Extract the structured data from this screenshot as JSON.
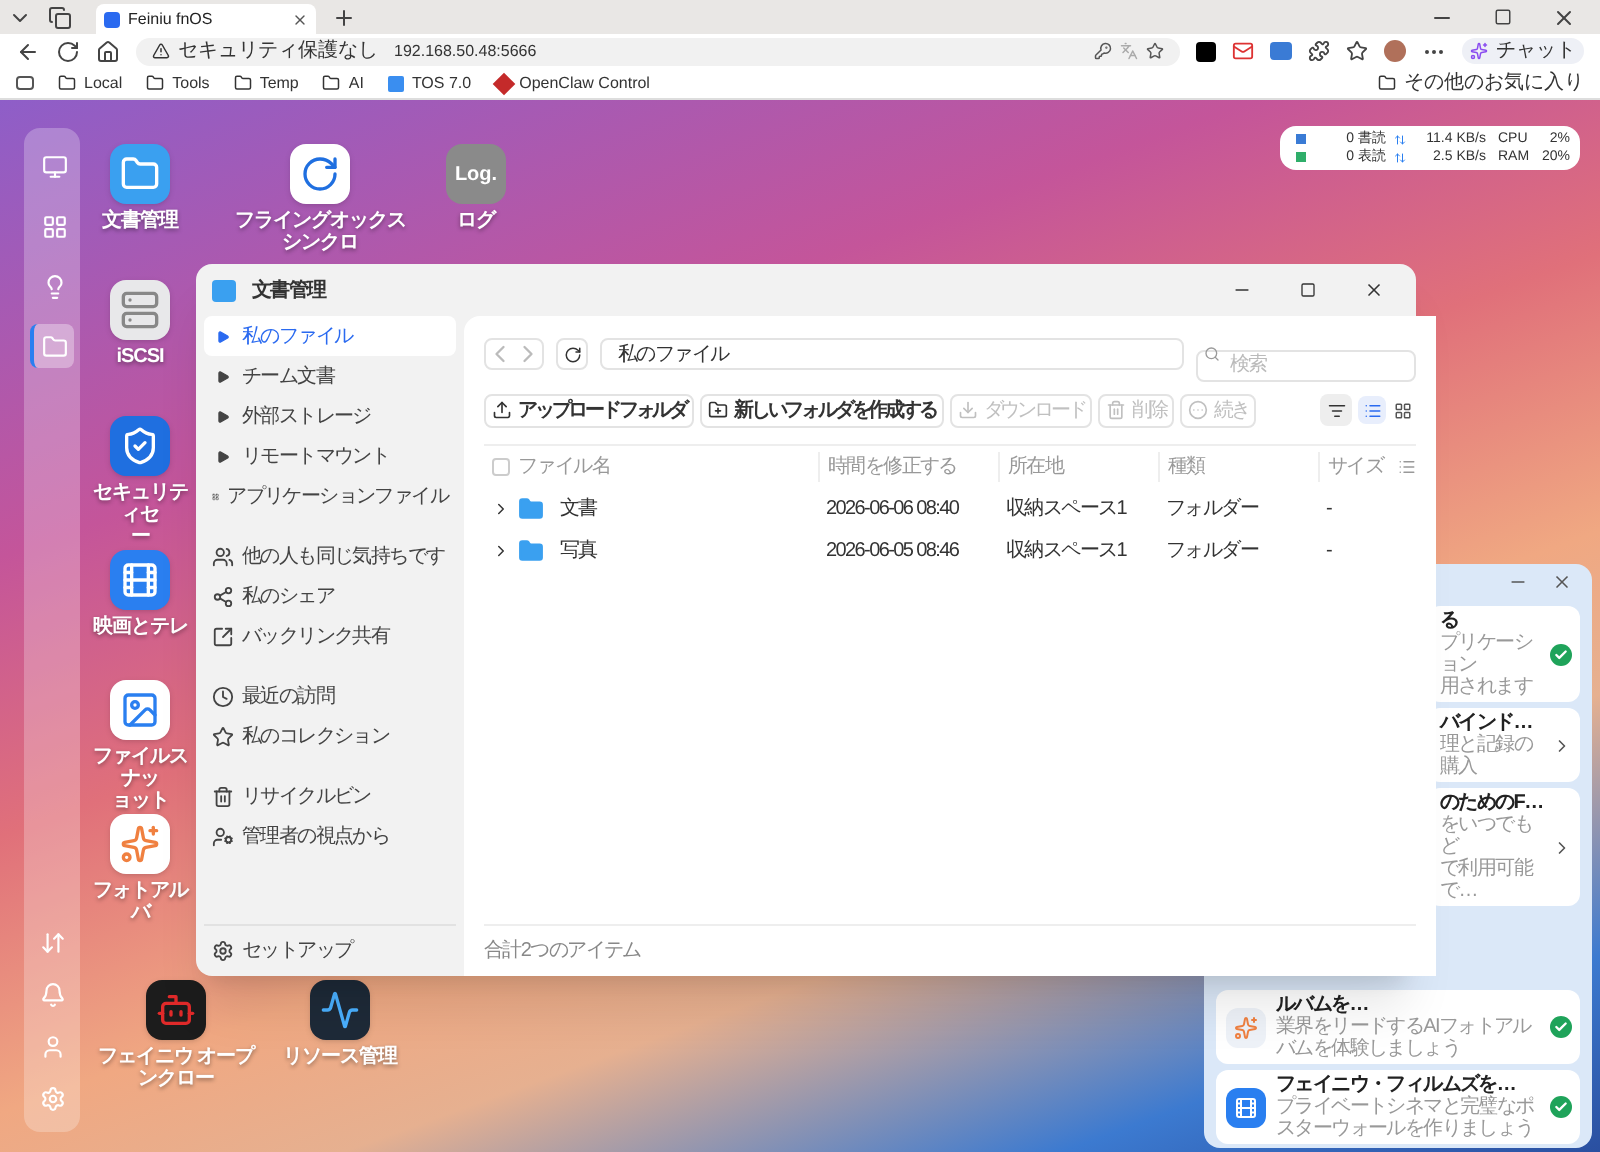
{
  "browser": {
    "tab_title": "Feiniu fnOS",
    "security": "セキュリティ保護なし",
    "url": "192.168.50.48:5666",
    "chat": "チャット",
    "bookmarks": [
      {
        "label": "Local",
        "kind": "folder"
      },
      {
        "label": "Tools",
        "kind": "folder"
      },
      {
        "label": "Temp",
        "kind": "folder"
      },
      {
        "label": "AI",
        "kind": "folder"
      },
      {
        "label": "TOS 7.0",
        "kind": "app"
      },
      {
        "label": "OpenClaw Control",
        "kind": "claw"
      }
    ],
    "other_favorites": "その他のお気に入り"
  },
  "dock": {
    "items": [
      {
        "kind": "monitor",
        "selected": false
      },
      {
        "kind": "apps",
        "selected": false
      },
      {
        "kind": "bulb",
        "selected": false
      },
      {
        "kind": "files",
        "selected": true
      }
    ],
    "bottom_items": [
      {
        "kind": "transfer"
      },
      {
        "kind": "bell"
      },
      {
        "kind": "user"
      },
      {
        "kind": "settings"
      }
    ]
  },
  "desktop_icons": [
    {
      "kind": "folder",
      "lines": [
        "文書管理"
      ]
    },
    {
      "kind": "sync",
      "lines": [
        "フライングオックス",
        "シンクロ"
      ]
    },
    {
      "kind": "log",
      "icon_text": "Log.",
      "lines": [
        "ログ"
      ]
    },
    {
      "kind": "server",
      "lines": [
        "iSCSI"
      ]
    },
    {
      "kind": "shield",
      "lines": [
        "セキュリティセ",
        "ー"
      ]
    },
    {
      "kind": "film",
      "lines": [
        "映画とテレ"
      ]
    },
    {
      "kind": "snapshot",
      "lines": [
        "ファイルスナッ",
        "ョット"
      ]
    },
    {
      "kind": "photos",
      "lines": [
        "フォトアルバ"
      ]
    },
    {
      "kind": "robot",
      "lines": [
        "フェイニウ オープ",
        "ンクロー"
      ]
    },
    {
      "kind": "monitor",
      "lines": [
        "リソース管理"
      ]
    }
  ],
  "widget": {
    "rows": [
      {
        "count": "0 書読",
        "rate": "11.4 KB/s",
        "metric": "CPU",
        "value": "2%"
      },
      {
        "count": "0 表読",
        "rate": "2.5 KB/s",
        "metric": "RAM",
        "value": "20%"
      }
    ]
  },
  "file_window": {
    "title": "文書管理",
    "sidebar": {
      "groups": [
        [
          {
            "label": "私のファイル",
            "kind": "tree",
            "selected": true
          },
          {
            "label": "チーム文書",
            "kind": "tree",
            "selected": false
          },
          {
            "label": "外部ストレージ",
            "kind": "tree",
            "selected": false
          },
          {
            "label": "リモートマウント",
            "kind": "tree",
            "selected": false
          },
          {
            "label": "アプリケーションファイル",
            "kind": "apps",
            "selected": false
          }
        ],
        [
          {
            "label": "他の人も同じ気持ちです",
            "kind": "people",
            "selected": false
          },
          {
            "label": "私のシェア",
            "kind": "share",
            "selected": false
          },
          {
            "label": "バックリンク共有",
            "kind": "backlink",
            "selected": false
          }
        ],
        [
          {
            "label": "最近の訪問",
            "kind": "recent",
            "selected": false
          },
          {
            "label": "私のコレクション",
            "kind": "star",
            "selected": false
          }
        ],
        [
          {
            "label": "リサイクルビン",
            "kind": "trash",
            "selected": false
          },
          {
            "label": "管理者の視点から",
            "kind": "admin",
            "selected": false
          }
        ]
      ],
      "setup": "セットアップ"
    },
    "path": "私のファイル",
    "search": {
      "placeholder": "検索"
    },
    "view_modes": [
      {
        "kind": "list",
        "selected": true
      },
      {
        "kind": "grid",
        "selected": false
      }
    ],
    "toolbar": [
      {
        "label": "アップロードフォルダ",
        "kind": "upload",
        "disabled": false
      },
      {
        "label": "新しいフォルダを作成する",
        "kind": "newfolder",
        "disabled": false
      },
      {
        "label": "ダウンロード",
        "kind": "download",
        "disabled": true
      },
      {
        "label": "削除",
        "kind": "delete",
        "disabled": true
      },
      {
        "label": "続き",
        "kind": "more",
        "disabled": true
      }
    ],
    "table": {
      "all_checked": false,
      "columns": [
        "ファイル名",
        "時間を修正する",
        "所在地",
        "種類",
        "サイズ"
      ],
      "rows": [
        {
          "name": "文書",
          "modified": "2026-06-06 08:40",
          "location": "収納スペース1",
          "type": "フォルダー",
          "size": "-"
        },
        {
          "name": "写真",
          "modified": "2026-06-05 08:46",
          "location": "収納スペース1",
          "type": "フォルダー",
          "size": "-"
        }
      ]
    },
    "footer": "合計2つのアイテム"
  },
  "notifications": {
    "items": [
      {
        "title": "る",
        "lines": [
          "プリケーション",
          "用されます"
        ],
        "kind": "done"
      },
      {
        "title": "バインド…",
        "lines": [
          "理と記録の購入"
        ],
        "kind": "link"
      },
      {
        "title": "のためのF…",
        "lines": [
          "をいつでもど",
          "で利用可能で…"
        ],
        "kind": "link"
      },
      {
        "title": "ルバムを…",
        "lines": [
          "業界をリードするAIフォトアルバムを体験しましょう"
        ],
        "kind": "done"
      },
      {
        "title": "フェイニウ・フィルムズを…",
        "lines": [
          "プライベートシネマと完璧なポスターウォールを作りましょう"
        ],
        "kind": "done"
      }
    ]
  }
}
